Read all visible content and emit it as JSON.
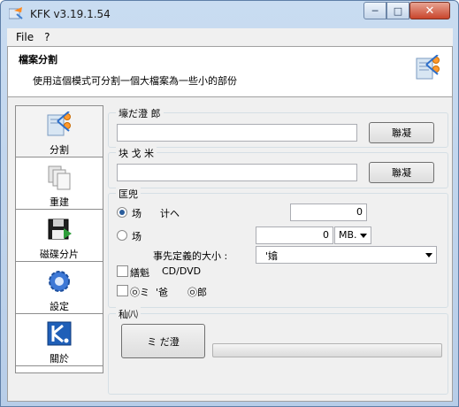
{
  "window": {
    "title": "KFK v3.19.1.54",
    "min_glyph": "─",
    "max_glyph": "□",
    "close_glyph": "✕"
  },
  "menu": {
    "file": "File",
    "help": "?"
  },
  "header": {
    "title": "檔案分割",
    "description": "使用這個模式可分割一個大檔案為一些小的部份"
  },
  "sidebar": {
    "items": [
      {
        "label": "分割",
        "icon": "split-icon"
      },
      {
        "label": "重建",
        "icon": "rebuild-icon"
      },
      {
        "label": "磁碟分片",
        "icon": "floppy-icon"
      },
      {
        "label": "設定",
        "icon": "gear-icon"
      },
      {
        "label": "關於",
        "icon": "about-icon"
      }
    ]
  },
  "source_group": {
    "label": "壕だ澄 郎",
    "value": "",
    "browse_label": "聯凝"
  },
  "target_group": {
    "label": "块 戈 米",
    "value": "",
    "browse_label": "聯凝"
  },
  "options_group": {
    "label": "匡兜",
    "radio1_label": "场",
    "radio1_suffix": "计ヘ",
    "radio1_value": "0",
    "radio2_label": "场",
    "radio2_value": "0",
    "unit_value": "MB.",
    "predefined_label": "事先定義的大小 :",
    "predefined_value": "'嬆",
    "check1_label": "繕魁",
    "check1_suffix": "CD/DVD",
    "check2_prefix": "㉧ミ",
    "check2_mid": "'爸",
    "check2_suffix": "㉧郎"
  },
  "progress_group": {
    "label": "秈㈧",
    "start_label": "ミ だ澄",
    "progress_fraction": 0
  },
  "colors": {
    "accent": "#2a5d9c",
    "progress_fill": "#37b24d"
  }
}
